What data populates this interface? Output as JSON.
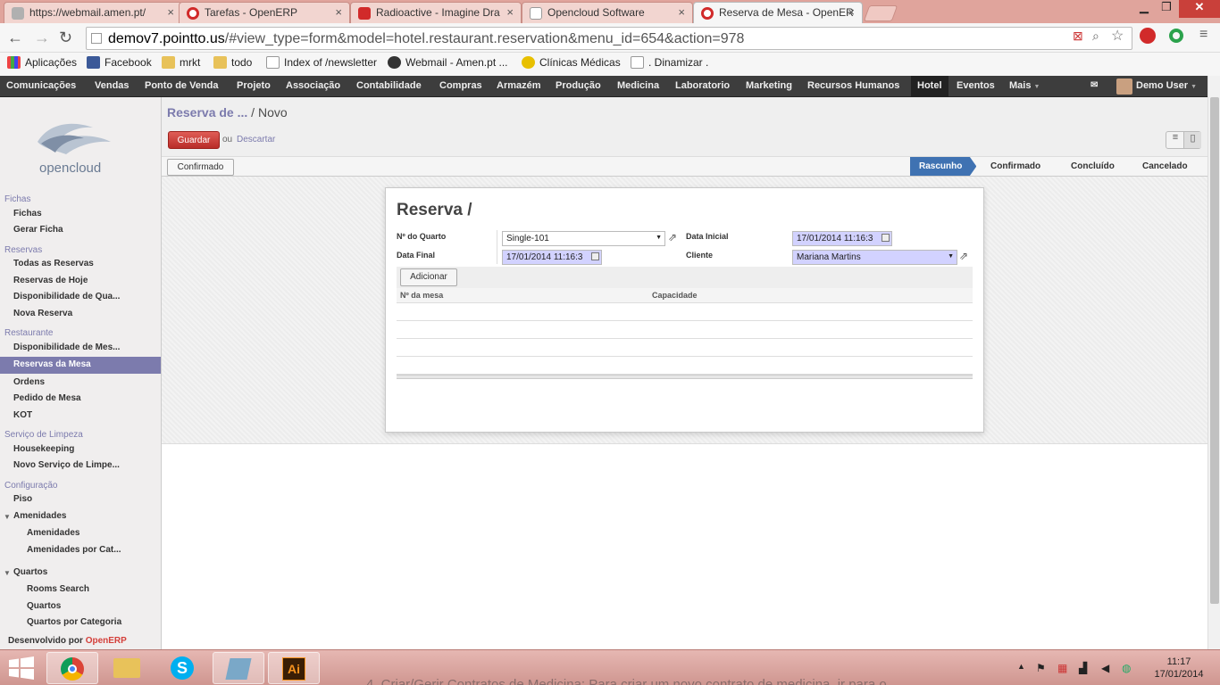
{
  "browser": {
    "tabs": [
      {
        "title": "https://webmail.amen.pt/",
        "active": false
      },
      {
        "title": "Tarefas - OpenERP",
        "active": false
      },
      {
        "title": "Radioactive - Imagine Dra",
        "active": false
      },
      {
        "title": "Opencloud Software",
        "active": false
      },
      {
        "title": "Reserva de Mesa - OpenER",
        "active": true
      }
    ],
    "url_host": "demov7.pointto.us",
    "url_rest": "/#view_type=form&model=hotel.restaurant.reservation&menu_id=654&action=978",
    "bookmarks": [
      "Aplicações",
      "Facebook",
      "mrkt",
      "todo",
      "Index of /newsletter",
      "Webmail - Amen.pt ...",
      "Clínicas Médicas",
      ". Dinamizar ."
    ]
  },
  "topmenu": {
    "items": [
      "Comunicações",
      "Vendas",
      "Ponto de Venda",
      "Projeto",
      "Associação",
      "Contabilidade",
      "Compras",
      "Armazém",
      "Produção",
      "Medicina",
      "Laboratorio",
      "Marketing",
      "Recursos Humanos",
      "Hotel",
      "Eventos",
      "Mais"
    ],
    "active": "Hotel",
    "user": "Demo User"
  },
  "sidebar": {
    "logo_text": "opencloud",
    "sections": [
      {
        "title": "Fichas",
        "items": [
          "Fichas",
          "Gerar Ficha"
        ]
      },
      {
        "title": "Reservas",
        "items": [
          "Todas as Reservas",
          "Reservas de Hoje",
          "Disponibilidade de Qua...",
          "Nova Reserva"
        ]
      },
      {
        "title": "Restaurante",
        "items": [
          "Disponibilidade de Mes...",
          "Reservas da Mesa",
          "Ordens",
          "Pedido de Mesa",
          "KOT"
        ]
      },
      {
        "title": "Serviço de Limpeza",
        "items": [
          "Housekeeping",
          "Novo Serviço de Limpe..."
        ]
      },
      {
        "title": "Configuração",
        "items": [
          "Piso",
          "Amenidades",
          "Amenidades",
          "Amenidades por Cat...",
          "Quartos",
          "Rooms Search",
          "Quartos",
          "Quartos por Categoria"
        ]
      }
    ],
    "selected": "Reservas da Mesa",
    "powered_prefix": "Desenvolvido por",
    "powered_brand": "OpenERP"
  },
  "main": {
    "breadcrumb_link": "Reserva de ...",
    "breadcrumb_sep": "/",
    "breadcrumb_current": "Novo",
    "save_label": "Guardar",
    "or_label": "ou",
    "discard_label": "Descartar",
    "status_button": "Confirmado",
    "stages": [
      "Rascunho",
      "Confirmado",
      "Concluído",
      "Cancelado"
    ],
    "active_stage": "Rascunho",
    "form": {
      "title": "Reserva /",
      "room_label": "Nº do Quarto",
      "room_value": "Single-101",
      "start_label": "Data Inicial",
      "start_value": "17/01/2014 11:16:3",
      "end_label": "Data Final",
      "end_value": "17/01/2014 11:16:3",
      "client_label": "Cliente",
      "client_value": "Mariana Martins",
      "add_button": "Adicionar",
      "col_table": "Nº da mesa",
      "col_capacity": "Capacidade"
    }
  },
  "taskbar": {
    "time": "11:17",
    "date": "17/01/2014",
    "background_text": "4. Criar/Gerir Contratos de Medicina: Para criar um novo contrato de medicina, ir para o"
  },
  "colors": {
    "accent": "#7c7bad",
    "save_red": "#b92c28",
    "stage_blue": "#3f72b2",
    "required_field": "#d2d2ff"
  }
}
